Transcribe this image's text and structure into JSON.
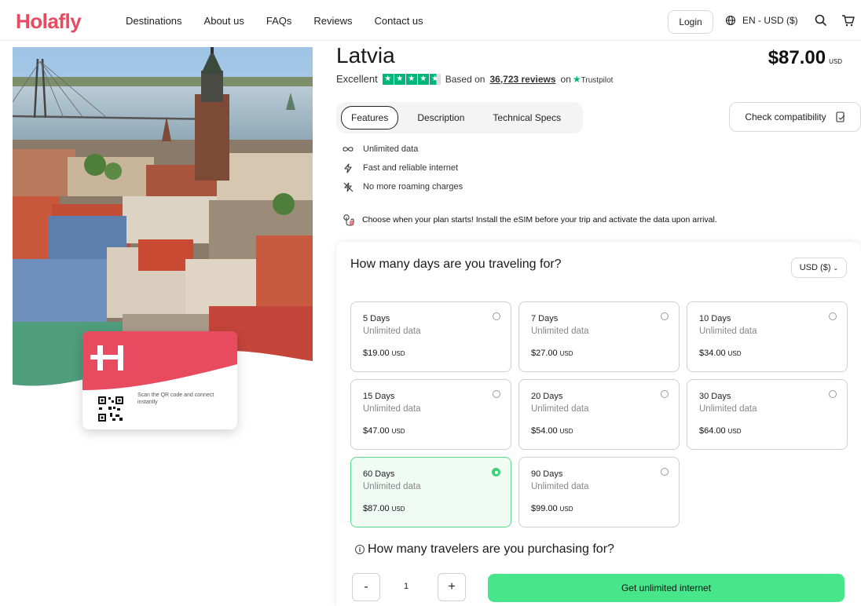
{
  "header": {
    "logo": "Holafly",
    "nav": [
      "Destinations",
      "About us",
      "FAQs",
      "Reviews",
      "Contact us"
    ],
    "login_label": "Login",
    "language": "EN - USD ($)",
    "icons": [
      "globe-icon",
      "search-icon",
      "cart-icon"
    ]
  },
  "esim_card": {
    "text": "Scan the QR code and connect instantly"
  },
  "product": {
    "title": "Latvia",
    "price": "$87.00",
    "price_currency": "USD",
    "rating_word": "Excellent",
    "rating_stars": 4.5,
    "based_on": "Based on",
    "reviews": "36,723 reviews",
    "on": "on",
    "trustpilot": "Trustpilot"
  },
  "tabs": [
    "Features",
    "Description",
    "Technical Specs"
  ],
  "compat_label": "Check compatibility",
  "features": [
    {
      "icon": "infinity-icon",
      "label": "Unlimited data"
    },
    {
      "icon": "bolt-icon",
      "label": "Fast and reliable internet"
    },
    {
      "icon": "no-roaming-icon",
      "label": "No more roaming charges"
    }
  ],
  "notice": "Choose when your plan starts! Install the eSIM before your trip and activate the data upon arrival.",
  "plan_panel": {
    "title": "How many days are you traveling for?",
    "currency": "USD ($)",
    "plans": [
      {
        "days": "5 Days",
        "data": "Unlimited data",
        "price": "$19.00",
        "cur": "USD",
        "selected": false
      },
      {
        "days": "7 Days",
        "data": "Unlimited data",
        "price": "$27.00",
        "cur": "USD",
        "selected": false
      },
      {
        "days": "10 Days",
        "data": "Unlimited data",
        "price": "$34.00",
        "cur": "USD",
        "selected": false
      },
      {
        "days": "15 Days",
        "data": "Unlimited data",
        "price": "$47.00",
        "cur": "USD",
        "selected": false
      },
      {
        "days": "20 Days",
        "data": "Unlimited data",
        "price": "$54.00",
        "cur": "USD",
        "selected": false
      },
      {
        "days": "30 Days",
        "data": "Unlimited data",
        "price": "$64.00",
        "cur": "USD",
        "selected": false
      },
      {
        "days": "60 Days",
        "data": "Unlimited data",
        "price": "$87.00",
        "cur": "USD",
        "selected": true
      },
      {
        "days": "90 Days",
        "data": "Unlimited data",
        "price": "$99.00",
        "cur": "USD",
        "selected": false
      }
    ],
    "travelers_title": "How many travelers are you purchasing for?",
    "minus": "-",
    "plus": "+",
    "quantity": "1",
    "buy_label": "Get unlimited internet"
  },
  "colors": {
    "brand": "#e84a5f",
    "cta": "#47e68a",
    "selected_border": "#56d98a",
    "trustpilot": "#00b67a"
  }
}
